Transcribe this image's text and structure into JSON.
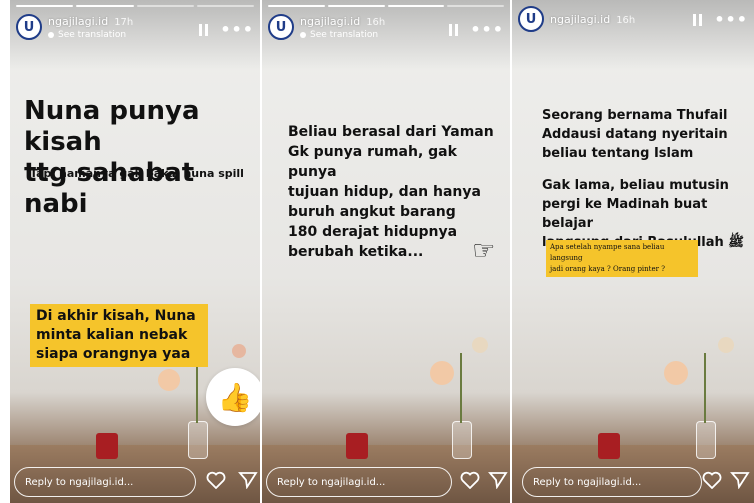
{
  "stories": [
    {
      "username": "ngajilagi.id",
      "time": "17h",
      "translation": "See translation",
      "heading": [
        "Nuna punya kisah",
        "ttg sahabat nabi"
      ],
      "subheading": "Tapi namanya gak bakal nuna spill",
      "highlight": [
        "Di akhir kisah, Nuna",
        "minta kalian nebak",
        "siapa orangnya yaa"
      ],
      "sticker_icon": "thumbs-up-icon",
      "reply_placeholder": "Reply to ngajilagi.id..."
    },
    {
      "username": "ngajilagi.id",
      "time": "16h",
      "translation": "See translation",
      "body": [
        "Beliau berasal dari Yaman",
        "Gk punya rumah, gak punya",
        "tujuan hidup, dan hanya",
        "buruh angkut barang"
      ],
      "body2": [
        "180 derajat hidupnya",
        "berubah ketika..."
      ],
      "pointer_icon": "pointing-hand-icon",
      "reply_placeholder": "Reply to ngajilagi.id..."
    },
    {
      "username": "ngajilagi.id",
      "time": "16h",
      "body": [
        "Seorang bernama Thufail",
        "Addausi datang nyeritain",
        "beliau tentang Islam"
      ],
      "body2": [
        "Gak lama, beliau mutusin",
        "pergi ke Madinah buat belajar",
        "langsung dari Rasulullah ﷺ"
      ],
      "note": [
        "Apa setelah nyampe sana beliau langsung",
        "jadi orang kaya ? Orang pinter ?"
      ],
      "reply_placeholder": "Reply to ngajilagi.id..."
    }
  ],
  "colors": {
    "highlight": "#f5c42b",
    "avatar_ring": "#1f3c88",
    "cup": "#a81e22"
  }
}
